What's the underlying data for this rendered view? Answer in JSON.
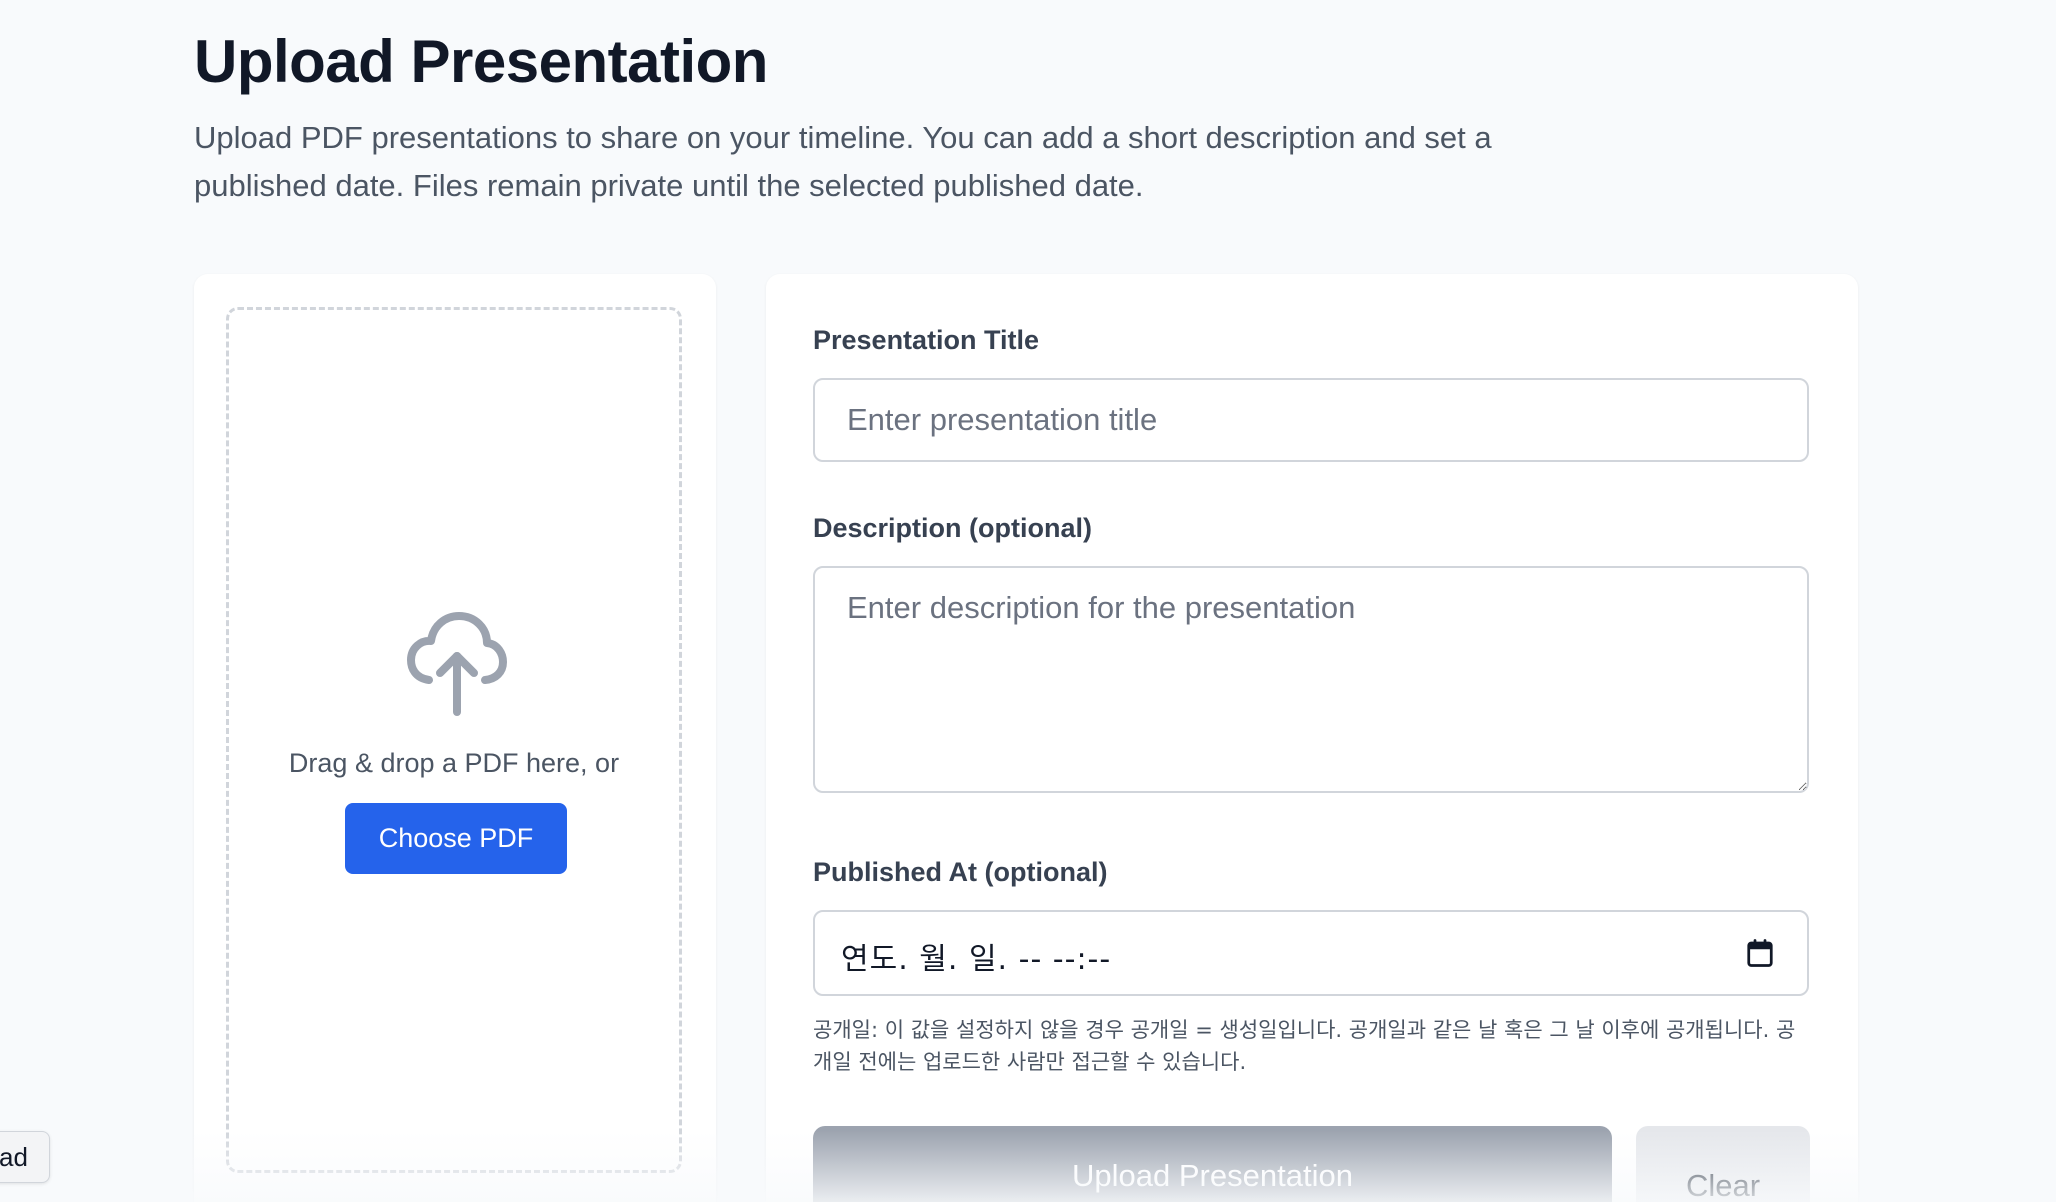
{
  "page": {
    "title": "Upload Presentation",
    "description": "Upload PDF presentations to share on your timeline. You can add a short description and set a published date. Files remain private until the selected published date."
  },
  "dropzone": {
    "icon": "cloud-upload-icon",
    "prompt": "Drag & drop a PDF here, or",
    "choose_label": "Choose PDF"
  },
  "form": {
    "title_label": "Presentation Title",
    "title_placeholder": "Enter presentation title",
    "description_label": "Description (optional)",
    "description_placeholder": "Enter description for the presentation",
    "published_label": "Published At (optional)",
    "published_value": "연도. 월. 일. -- --:--",
    "help_text": "공개일: 이 값을 설정하지 않을 경우 공개일 = 생성일입니다. 공개일과 같은 날 혹은 그 날 이후에 공개됩니다. 공개일 전에는 업로드한 사람만 접근할 수 있습니다.",
    "upload_label": "Upload Presentation",
    "clear_label": "Clear"
  },
  "side_tab": {
    "label": "ad"
  },
  "colors": {
    "primary": "#2563eb",
    "disabled": "#9ca3af",
    "secondary": "#e5e7eb",
    "background": "#f8fafc"
  }
}
